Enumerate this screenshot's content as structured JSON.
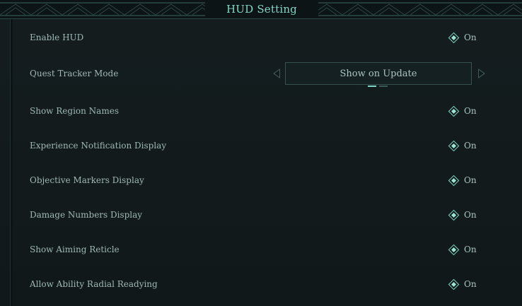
{
  "header": {
    "title": "HUD Setting"
  },
  "settings": [
    {
      "label": "Enable HUD",
      "type": "toggle",
      "value": "On"
    },
    {
      "label": "Quest Tracker Mode",
      "type": "selector",
      "value": "Show on Update",
      "page_count": 2,
      "active_page": 0
    },
    {
      "label": "Show Region Names",
      "type": "toggle",
      "value": "On"
    },
    {
      "label": "Experience Notification Display",
      "type": "toggle",
      "value": "On"
    },
    {
      "label": "Objective Markers Display",
      "type": "toggle",
      "value": "On"
    },
    {
      "label": "Damage Numbers Display",
      "type": "toggle",
      "value": "On"
    },
    {
      "label": "Show Aiming Reticle",
      "type": "toggle",
      "value": "On"
    },
    {
      "label": "Allow Ability Radial Readying",
      "type": "toggle",
      "value": "On"
    }
  ],
  "icons": {
    "toggle": "diamond-checkbox-icon",
    "prev": "arrow-left-icon",
    "next": "arrow-right-icon"
  },
  "colors": {
    "accent": "#7fd7c6",
    "text": "#9eb8b4",
    "background": "#121a1c"
  }
}
